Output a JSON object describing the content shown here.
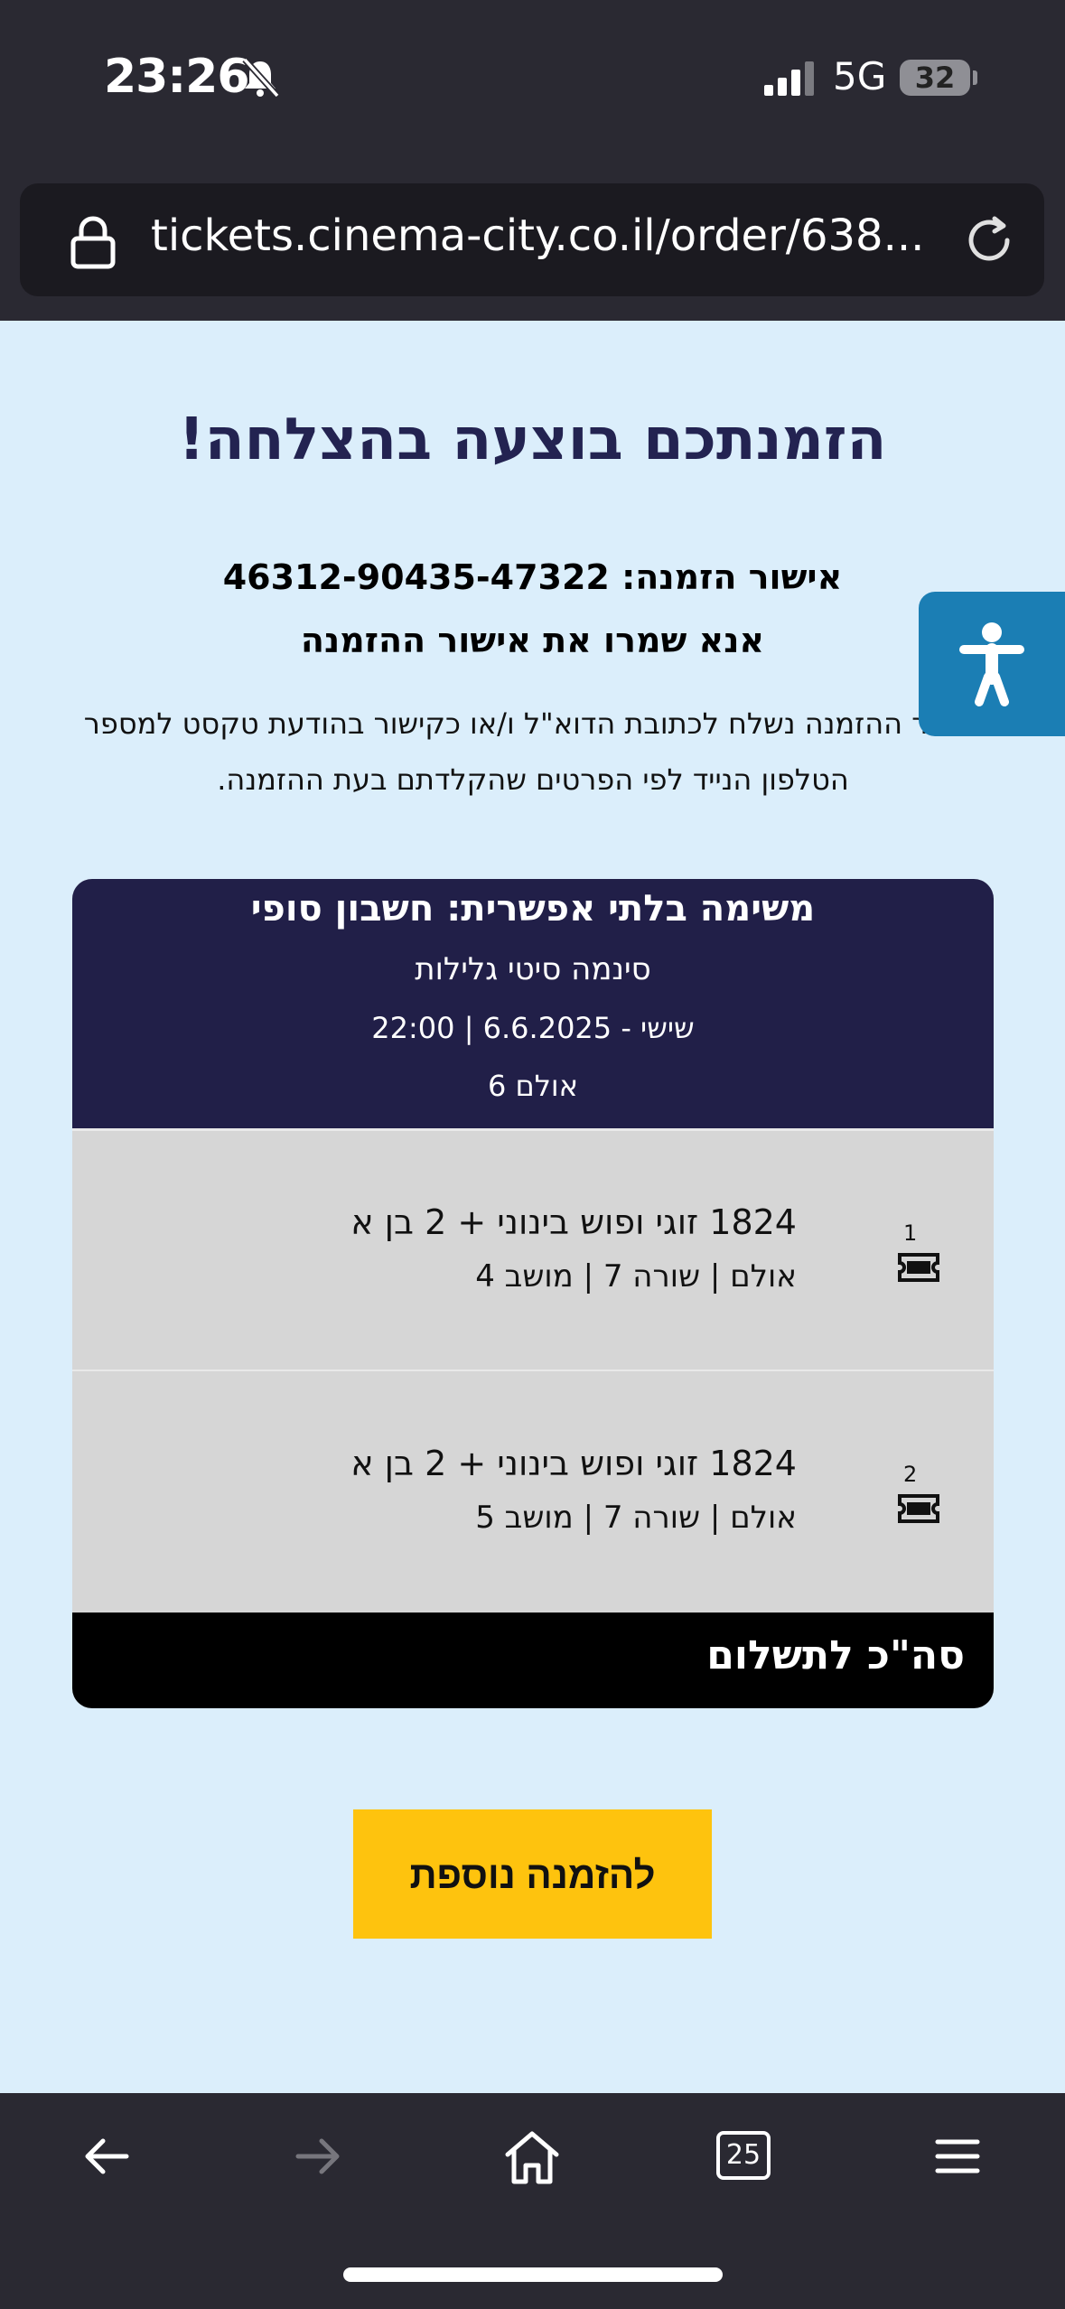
{
  "status_bar": {
    "time": "23:26",
    "network": "5G",
    "battery": "32"
  },
  "browser": {
    "url": "tickets.cinema-city.co.il/order/638..."
  },
  "page": {
    "title": "הזמנתכם בוצעה בהצלחה!",
    "confirmation_line": "אישור הזמנה: 46312-90435-47322",
    "keep_confirmation": "אנא שמרו את אישור ההזמנה",
    "info_text": "אישור ההזמנה נשלח לכתובת הדוא\"ל ו/או כקישור בהודעת טקסט למספר הטלפון הנייד לפי הפרטים שהקלדתם בעת ההזמנה."
  },
  "summary": {
    "header_title": "משימה בלתי אפשרית: חשבון סופי",
    "cinema": "סינמה סיטי גלילות",
    "datetime": "שישי - 6.6.2025 | 22:00",
    "hall": "אולם 6",
    "items": [
      {
        "num": "1",
        "name": "1824 זוגי ופוש בינוני + 2 בן א",
        "seat": "אולם | שורה 7 | מושב 4"
      },
      {
        "num": "2",
        "name": "1824 זוגי ופוש בינוני + 2 בן א",
        "seat": "אולם | שורה 7 | מושב 5"
      }
    ],
    "total_label": "סה\"כ לתשלום"
  },
  "actions": {
    "another_order": "להזמנה נוספת"
  },
  "toolbar": {
    "tabs_count": "25"
  },
  "colors": {
    "page_bg": "#dbeefb",
    "title": "#232351",
    "card_header": "#211f48",
    "accent_button": "#fec30e",
    "accessibility": "#1b7eb4"
  },
  "icons": [
    "bell-slash-icon",
    "signal-icon",
    "lock-icon",
    "reload-icon",
    "accessibility-icon",
    "ticket-icon",
    "back-icon",
    "forward-icon",
    "home-icon",
    "tabs-icon",
    "menu-icon"
  ]
}
